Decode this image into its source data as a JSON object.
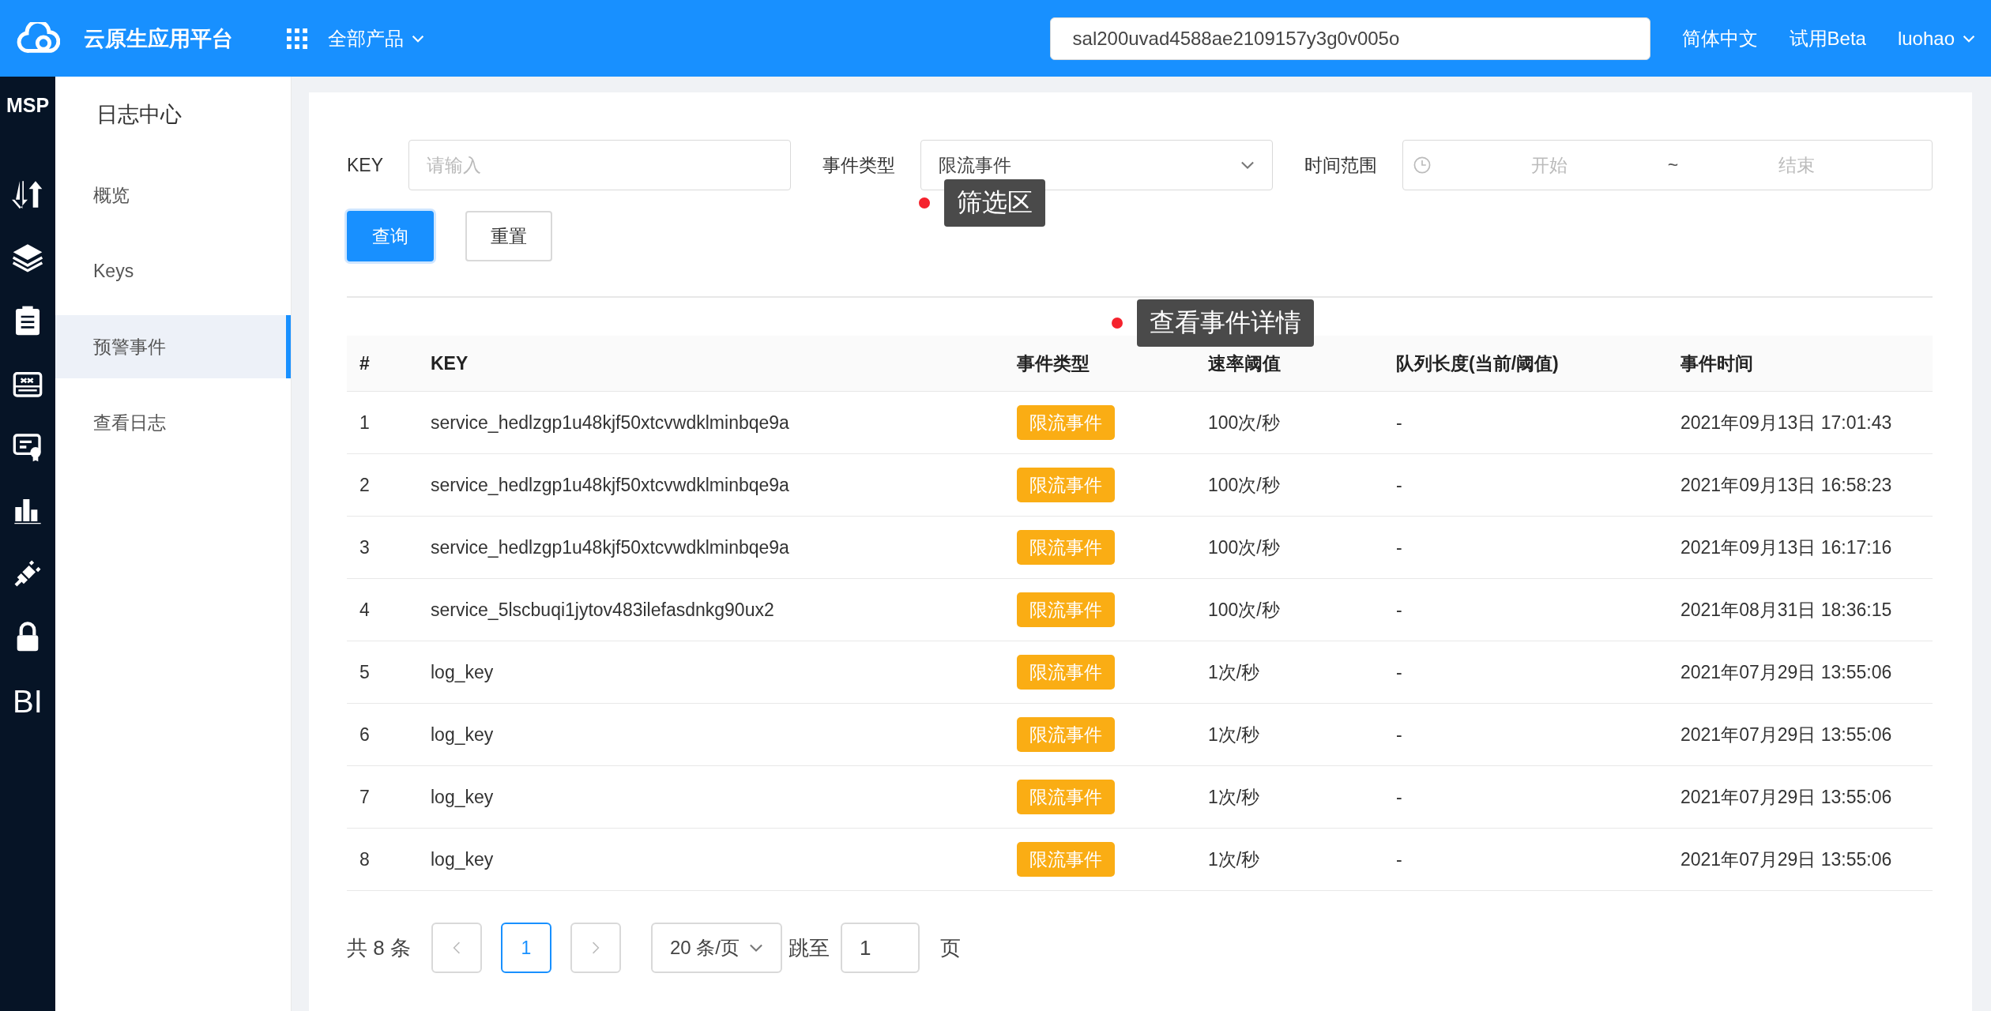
{
  "header": {
    "title": "云原生应用平台",
    "products": "全部产品",
    "search_value": "sal200uvad4588ae2109157y3g0v005o",
    "links": [
      "简体中文",
      "试用Beta"
    ],
    "user": "luohao"
  },
  "rail": {
    "logo": "MSP",
    "bottom_text": "BI",
    "icons": [
      {
        "kind": "transfer"
      },
      {
        "kind": "layers"
      },
      {
        "kind": "clipboard"
      },
      {
        "kind": "switch"
      },
      {
        "kind": "certificate"
      },
      {
        "kind": "chart"
      },
      {
        "kind": "plug"
      },
      {
        "kind": "lock"
      }
    ]
  },
  "sidebar": {
    "title": "日志中心",
    "items": [
      {
        "label": "概览",
        "selected": false
      },
      {
        "label": "Keys",
        "selected": false
      },
      {
        "label": "预警事件",
        "selected": true
      },
      {
        "label": "查看日志",
        "selected": false
      }
    ]
  },
  "filters": {
    "key_label": "KEY",
    "key_placeholder": "请输入",
    "type_label": "事件类型",
    "type_value": "限流事件",
    "time_label": "时间范围",
    "time_start_placeholder": "开始",
    "time_separator": "~",
    "time_end_placeholder": "结束",
    "query_button": "查询",
    "reset_button": "重置"
  },
  "annotations": [
    {
      "text": "筛选区"
    },
    {
      "text": "查看事件详情"
    }
  ],
  "table": {
    "columns": [
      "#",
      "KEY",
      "事件类型",
      "速率阈值",
      "队列长度(当前/阈值)",
      "事件时间"
    ],
    "rows": [
      {
        "index": "1",
        "key": "service_hedlzgp1u48kjf50xtcvwdklminbqe9a",
        "type": "限流事件",
        "rate": "100次/秒",
        "queue": "-",
        "time": "2021年09月13日 17:01:43"
      },
      {
        "index": "2",
        "key": "service_hedlzgp1u48kjf50xtcvwdklminbqe9a",
        "type": "限流事件",
        "rate": "100次/秒",
        "queue": "-",
        "time": "2021年09月13日 16:58:23"
      },
      {
        "index": "3",
        "key": "service_hedlzgp1u48kjf50xtcvwdklminbqe9a",
        "type": "限流事件",
        "rate": "100次/秒",
        "queue": "-",
        "time": "2021年09月13日 16:17:16"
      },
      {
        "index": "4",
        "key": "service_5lscbuqi1jytov483ilefasdnkg90ux2",
        "type": "限流事件",
        "rate": "100次/秒",
        "queue": "-",
        "time": "2021年08月31日 18:36:15"
      },
      {
        "index": "5",
        "key": "log_key",
        "type": "限流事件",
        "rate": "1次/秒",
        "queue": "-",
        "time": "2021年07月29日 13:55:06"
      },
      {
        "index": "6",
        "key": "log_key",
        "type": "限流事件",
        "rate": "1次/秒",
        "queue": "-",
        "time": "2021年07月29日 13:55:06"
      },
      {
        "index": "7",
        "key": "log_key",
        "type": "限流事件",
        "rate": "1次/秒",
        "queue": "-",
        "time": "2021年07月29日 13:55:06"
      },
      {
        "index": "8",
        "key": "log_key",
        "type": "限流事件",
        "rate": "1次/秒",
        "queue": "-",
        "time": "2021年07月29日 13:55:06"
      }
    ]
  },
  "pagination": {
    "total": "共 8 条",
    "pages": [
      {
        "label": "1",
        "selected": true
      }
    ],
    "page_size": "20 条/页",
    "jump_label": "跳至",
    "jump_value": "1",
    "page_suffix": "页"
  }
}
